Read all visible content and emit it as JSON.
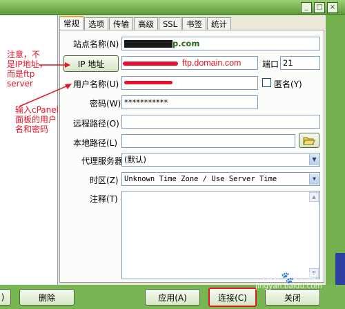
{
  "window": {
    "minimize_label": "_",
    "maximize_label": "□",
    "close_label": "×"
  },
  "tabs": [
    "常规",
    "选项",
    "传输",
    "高级",
    "SSL",
    "书签",
    "统计"
  ],
  "form": {
    "site_name_label": "站点名称",
    "site_name_hotkey": "(N)",
    "site_name_value_suffix": "p.com",
    "ip_button_label": "IP 地址",
    "ip_value": "ftp.domain.com",
    "port_label": "端口",
    "port_value": "21",
    "username_label": "用户名称",
    "username_hotkey": "(U)",
    "anonymous_label": "匿名",
    "anonymous_hotkey": "(Y)",
    "password_label": "密码",
    "password_hotkey": "(W)",
    "password_value": "***********",
    "remote_path_label": "远程路径",
    "remote_path_hotkey": "(O)",
    "local_path_label": "本地路径",
    "local_path_hotkey": "(L)",
    "proxy_label": "代理服务器",
    "proxy_value": "(默认)",
    "timezone_label": "时区",
    "timezone_hotkey": "(Z)",
    "timezone_value": "Unknown Time Zone / Use Server Time",
    "comment_label": "注释",
    "comment_hotkey": "(T)"
  },
  "buttons": {
    "left_partial": ")",
    "delete": "删除",
    "apply": "应用(A)",
    "connect": "连接(C)",
    "close": "关闭"
  },
  "annotations": {
    "note1_lines": [
      "注意，不",
      "是IP地址，",
      "而是ftp",
      "server"
    ],
    "note2_lines": [
      "输入cPanel",
      "面板的用户",
      "名和密码"
    ]
  },
  "watermark": {
    "logo": "Bai",
    "logo2": "经验",
    "url": "jingyan.baidu.com"
  },
  "colors": {
    "annotation_red": "#e51426",
    "window_green": "#78b653",
    "dialog_bg": "#ece9d8",
    "active_tab_accent": "#e6a62c"
  }
}
